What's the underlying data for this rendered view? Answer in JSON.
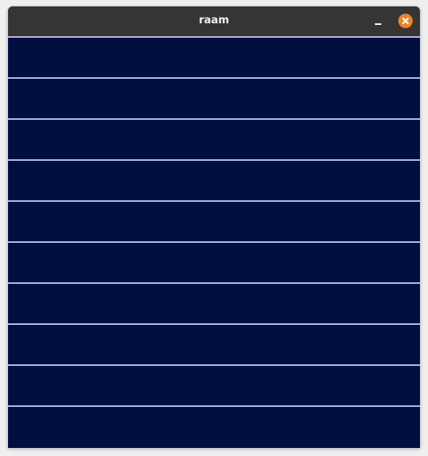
{
  "window": {
    "title": "raam"
  },
  "controls": {
    "minimize_icon": "minimize-icon",
    "close_icon": "close-icon",
    "close_color": "#f08224"
  },
  "canvas": {
    "background_color": "#000e40",
    "line_color": "#aeb8ec",
    "row_count": 10
  }
}
